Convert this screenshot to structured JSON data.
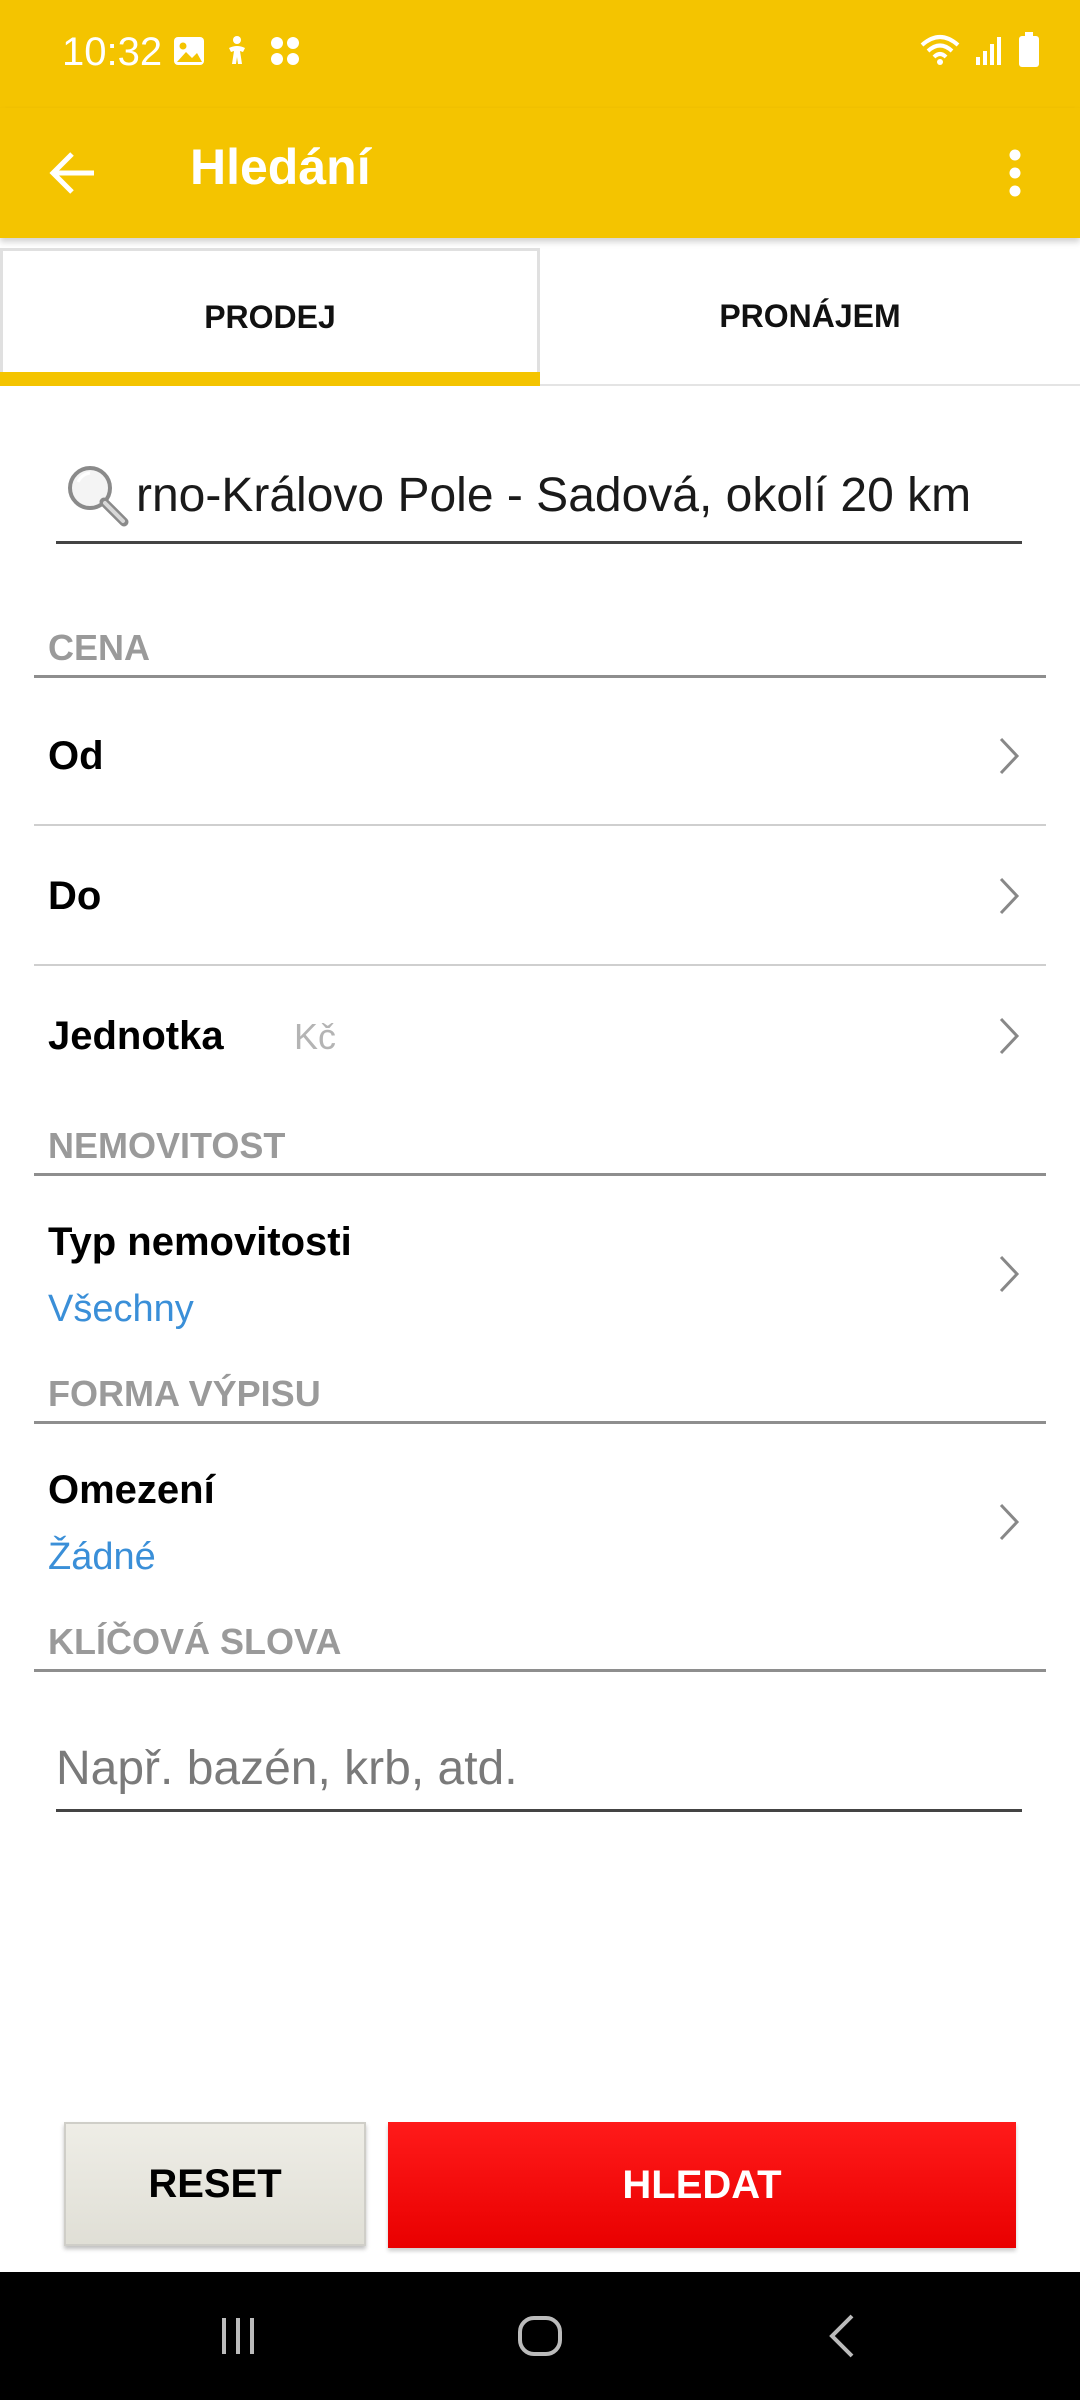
{
  "status_bar": {
    "time": "10:32",
    "left_icons": [
      "image-icon",
      "accessibility-icon",
      "apps-icon"
    ],
    "right_icons": [
      "wifi-icon",
      "signal-icon",
      "battery-icon"
    ]
  },
  "app_bar": {
    "title": "Hledání",
    "back_icon": "arrow-left-icon",
    "menu_icon": "more-vert-icon"
  },
  "tabs": [
    {
      "label": "PRODEJ",
      "active": true
    },
    {
      "label": "PRONÁJEM",
      "active": false
    }
  ],
  "search": {
    "value": "rno-Královo Pole - Sadová, okolí 20 km",
    "icon": "search-icon"
  },
  "sections": {
    "price": {
      "header": "CENA",
      "from_label": "Od",
      "to_label": "Do",
      "unit_label": "Jednotka",
      "unit_value": "Kč"
    },
    "property": {
      "header": "NEMOVITOST",
      "type_label": "Typ nemovitosti",
      "type_value": "Všechny"
    },
    "listing": {
      "header": "FORMA VÝPISU",
      "limit_label": "Omezení",
      "limit_value": "Žádné"
    },
    "keywords": {
      "header": "KLÍČOVÁ SLOVA",
      "placeholder": "Např. bazén, krb, atd."
    }
  },
  "buttons": {
    "reset": "RESET",
    "search": "HLEDAT"
  },
  "colors": {
    "accent": "#f4c400",
    "link": "#3a8fd8",
    "primary_button": "#ff0000"
  }
}
